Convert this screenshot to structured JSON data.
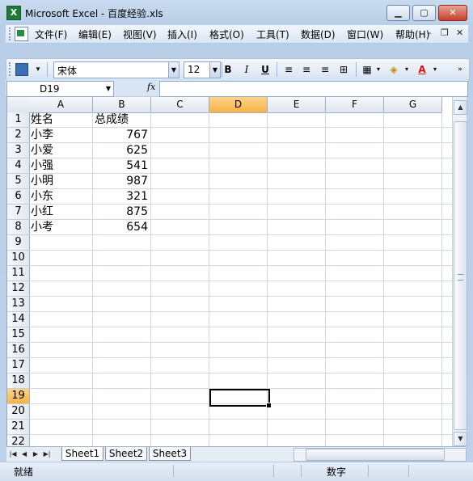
{
  "window": {
    "title": "Microsoft Excel - 百度经验.xls",
    "app_icon": "excel-icon"
  },
  "menu": {
    "items": [
      "文件(F)",
      "编辑(E)",
      "视图(V)",
      "插入(I)",
      "格式(O)",
      "工具(T)",
      "数据(D)",
      "窗口(W)",
      "帮助(H)"
    ]
  },
  "toolbar": {
    "font_name": "宋体",
    "font_size": "12",
    "bold": "B",
    "italic": "I",
    "underline": "U",
    "font_color_label": "A"
  },
  "formula_bar": {
    "name_box": "D19",
    "fx": "fx",
    "value": ""
  },
  "grid": {
    "columns": [
      "A",
      "B",
      "C",
      "D",
      "E",
      "F",
      "G"
    ],
    "selected_column": "D",
    "rows": [
      "1",
      "2",
      "3",
      "4",
      "5",
      "6",
      "7",
      "8",
      "9",
      "10",
      "11",
      "12",
      "13",
      "14",
      "15",
      "16",
      "17",
      "18",
      "19",
      "20",
      "21",
      "22"
    ],
    "selected_row": "19",
    "header": {
      "name": "姓名",
      "score": "总成绩"
    },
    "records": [
      {
        "name": "小李",
        "score": "767"
      },
      {
        "name": "小爱",
        "score": "625"
      },
      {
        "name": "小强",
        "score": "541"
      },
      {
        "name": "小明",
        "score": "987"
      },
      {
        "name": "小东",
        "score": "321"
      },
      {
        "name": "小红",
        "score": "875"
      },
      {
        "name": "小考",
        "score": "654"
      }
    ]
  },
  "sheets": {
    "tabs": [
      "Sheet1",
      "Sheet2",
      "Sheet3"
    ],
    "active": "Sheet1"
  },
  "status": {
    "left": "就绪",
    "mode": "数字"
  },
  "colors": {
    "selected_header": "#f7b244",
    "grid_line": "#d0d7e5",
    "title_bg": "#c9dbef"
  }
}
